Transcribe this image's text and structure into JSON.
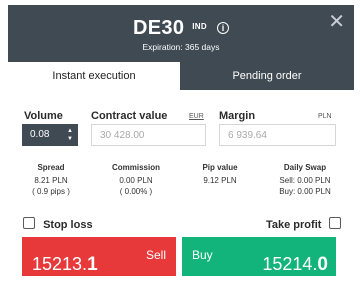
{
  "header": {
    "title": "DE30",
    "badge": "IND",
    "expiration": "Expiration: 365 days",
    "info_icon": "i",
    "close_icon": "✕"
  },
  "tabs": [
    {
      "label": "Instant execution",
      "active": true
    },
    {
      "label": "Pending order",
      "active": false
    }
  ],
  "volume": {
    "label": "Volume",
    "value": "0.08"
  },
  "contract_value": {
    "label": "Contract value",
    "unit": "EUR",
    "value": "30 428.00"
  },
  "margin": {
    "label": "Margin",
    "unit": "PLN",
    "value": "6 939.64"
  },
  "stats": {
    "spread": {
      "title": "Spread",
      "line1": "8.21 PLN",
      "line2": "( 0.9 pips )"
    },
    "commission": {
      "title": "Commission",
      "line1": "0.00 PLN",
      "line2": "( 0.00% )"
    },
    "pip_value": {
      "title": "Pip value",
      "line1": "9.12 PLN"
    },
    "daily_swap": {
      "title": "Daily Swap",
      "line1": "Sell: 0.00 PLN",
      "line2": "Buy: 0.00 PLN"
    }
  },
  "options": {
    "stop_loss": {
      "label": "Stop loss",
      "checked": false
    },
    "take_profit": {
      "label": "Take profit",
      "checked": false
    }
  },
  "sell": {
    "label": "Sell",
    "price_prefix": "15213.",
    "price_last": "1",
    "color": "#e8393a"
  },
  "buy": {
    "label": "Buy",
    "price_prefix": "15214.",
    "price_last": "0",
    "color": "#13b37c"
  },
  "colors": {
    "header_bg": "#3f4a53"
  }
}
